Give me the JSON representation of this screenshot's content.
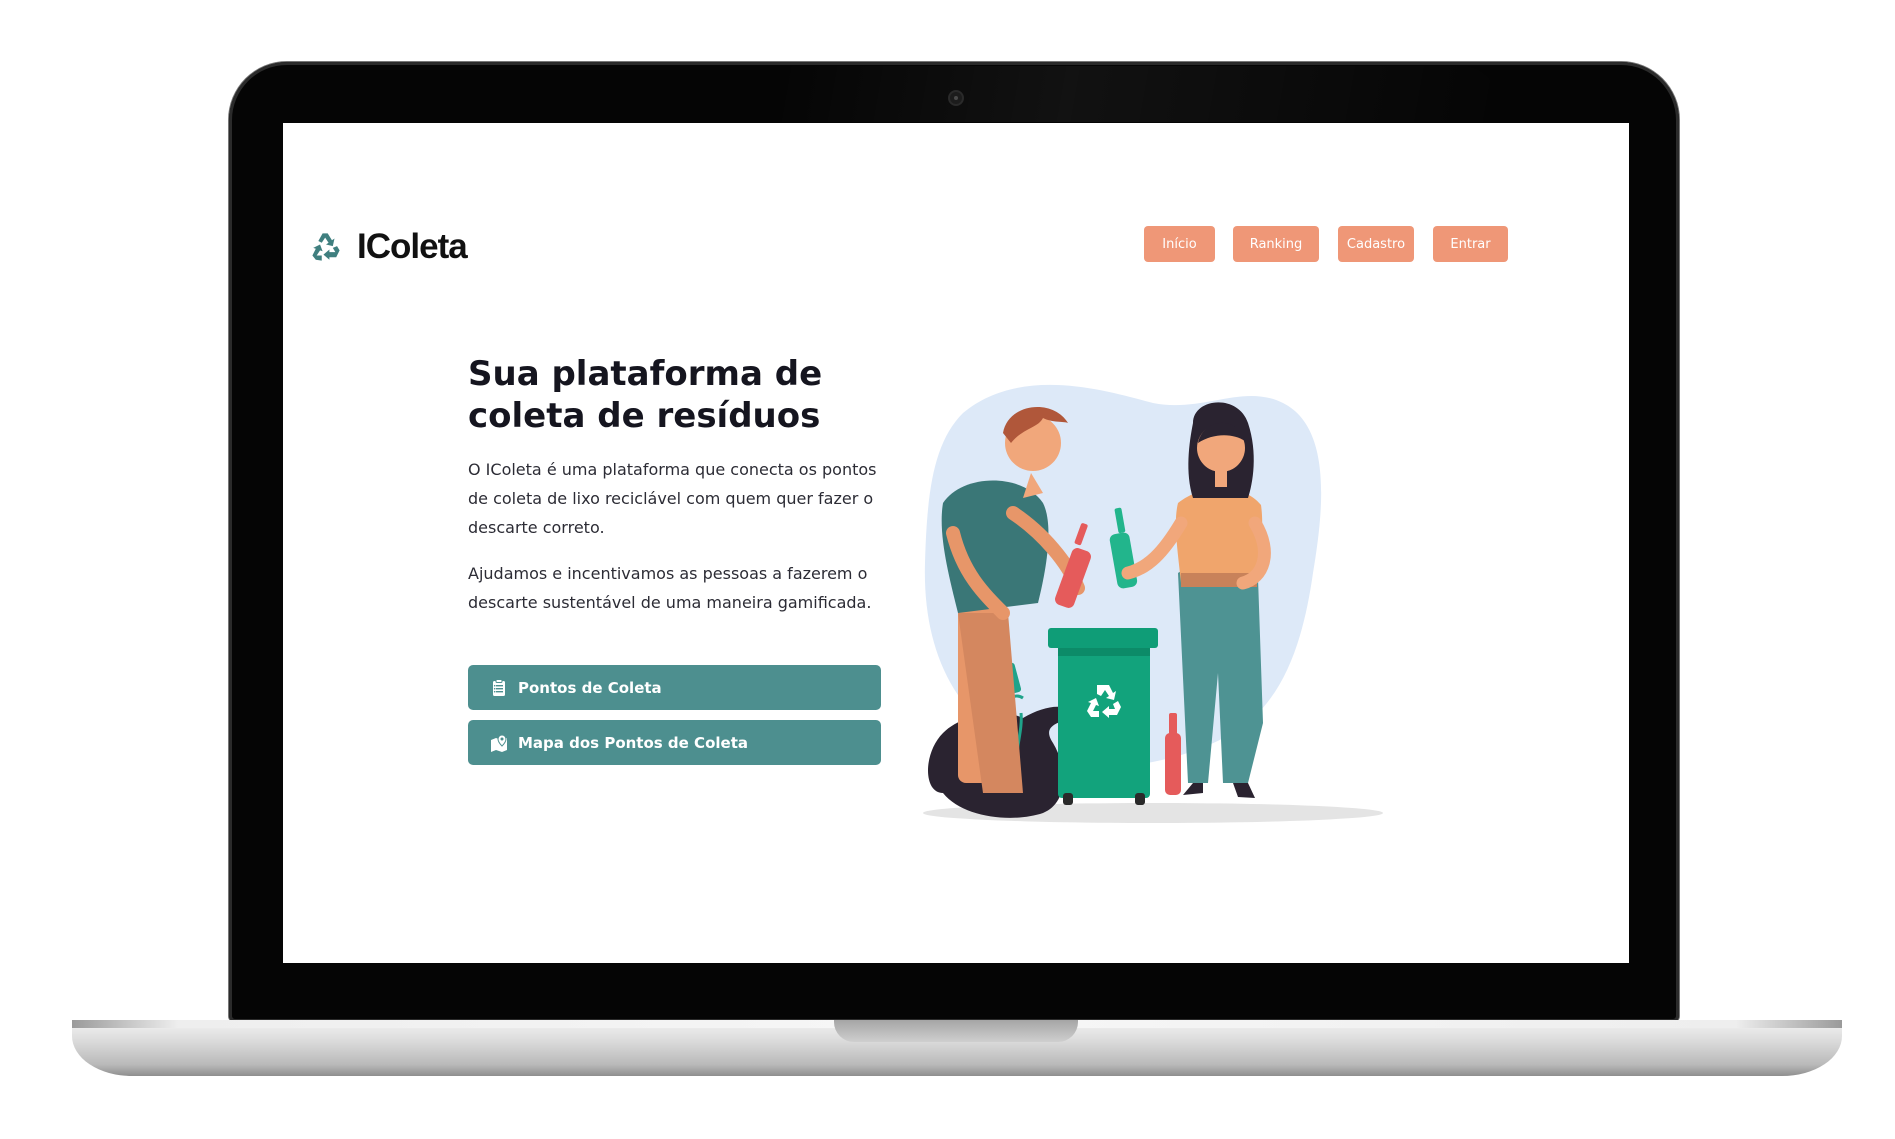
{
  "brand": {
    "name": "IColeta",
    "logo_icon": "recycle-icon"
  },
  "nav": {
    "items": [
      {
        "label": "Início"
      },
      {
        "label": "Ranking"
      },
      {
        "label": "Cadastro"
      },
      {
        "label": "Entrar"
      }
    ]
  },
  "hero": {
    "title_line1": "Sua plataforma de",
    "title_line2": "coleta de resíduos",
    "paragraph1": "O IColeta é uma plataforma que conecta os pontos de coleta de lixo reciclável com quem quer fazer o descarte correto.",
    "paragraph2": "Ajudamos e incentivamos as pessoas a fazerem o descarte sustentável de uma maneira gamificada."
  },
  "actions": {
    "primary": {
      "label": "Pontos de Coleta",
      "icon": "clipboard-list-icon"
    },
    "secondary": {
      "label": "Mapa dos Pontos de Coleta",
      "icon": "map-pin-icon"
    }
  },
  "colors": {
    "nav_button": "#ef9777",
    "cta_button": "#4d8f8f",
    "recycle_bin": "#0f9d77",
    "title": "#15151f"
  }
}
